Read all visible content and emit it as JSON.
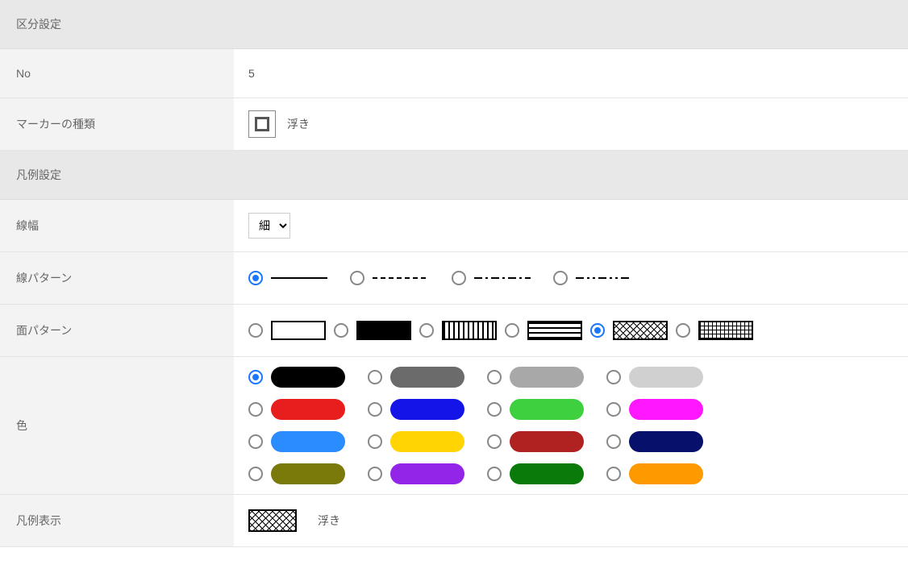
{
  "sections": {
    "division": "区分設定",
    "legend": "凡例設定"
  },
  "labels": {
    "no": "No",
    "marker_type": "マーカーの種類",
    "line_width": "線幅",
    "line_pattern": "線パターン",
    "fill_pattern": "面パターン",
    "color": "色",
    "legend_display": "凡例表示"
  },
  "values": {
    "no": "5",
    "marker_type": "浮き",
    "line_width_selected": "細",
    "legend_display": "浮き"
  },
  "line_patterns": {
    "selected_index": 0,
    "options": [
      "solid",
      "dashed",
      "dash-dot",
      "dash-dot-dot"
    ]
  },
  "fill_patterns": {
    "selected_index": 4,
    "options": [
      "none",
      "solid",
      "vertical-lines",
      "horizontal-lines",
      "crosshatch",
      "grid"
    ]
  },
  "colors": {
    "selected_index": 0,
    "options": [
      "#000000",
      "#6b6b6b",
      "#a8a8a8",
      "#d0d0d0",
      "#e81e1e",
      "#1414e8",
      "#3fd03f",
      "#ff18ff",
      "#2a8cff",
      "#ffd400",
      "#b02222",
      "#07116b",
      "#7a7a0a",
      "#9325e8",
      "#0a7a0a",
      "#ff9900"
    ]
  }
}
